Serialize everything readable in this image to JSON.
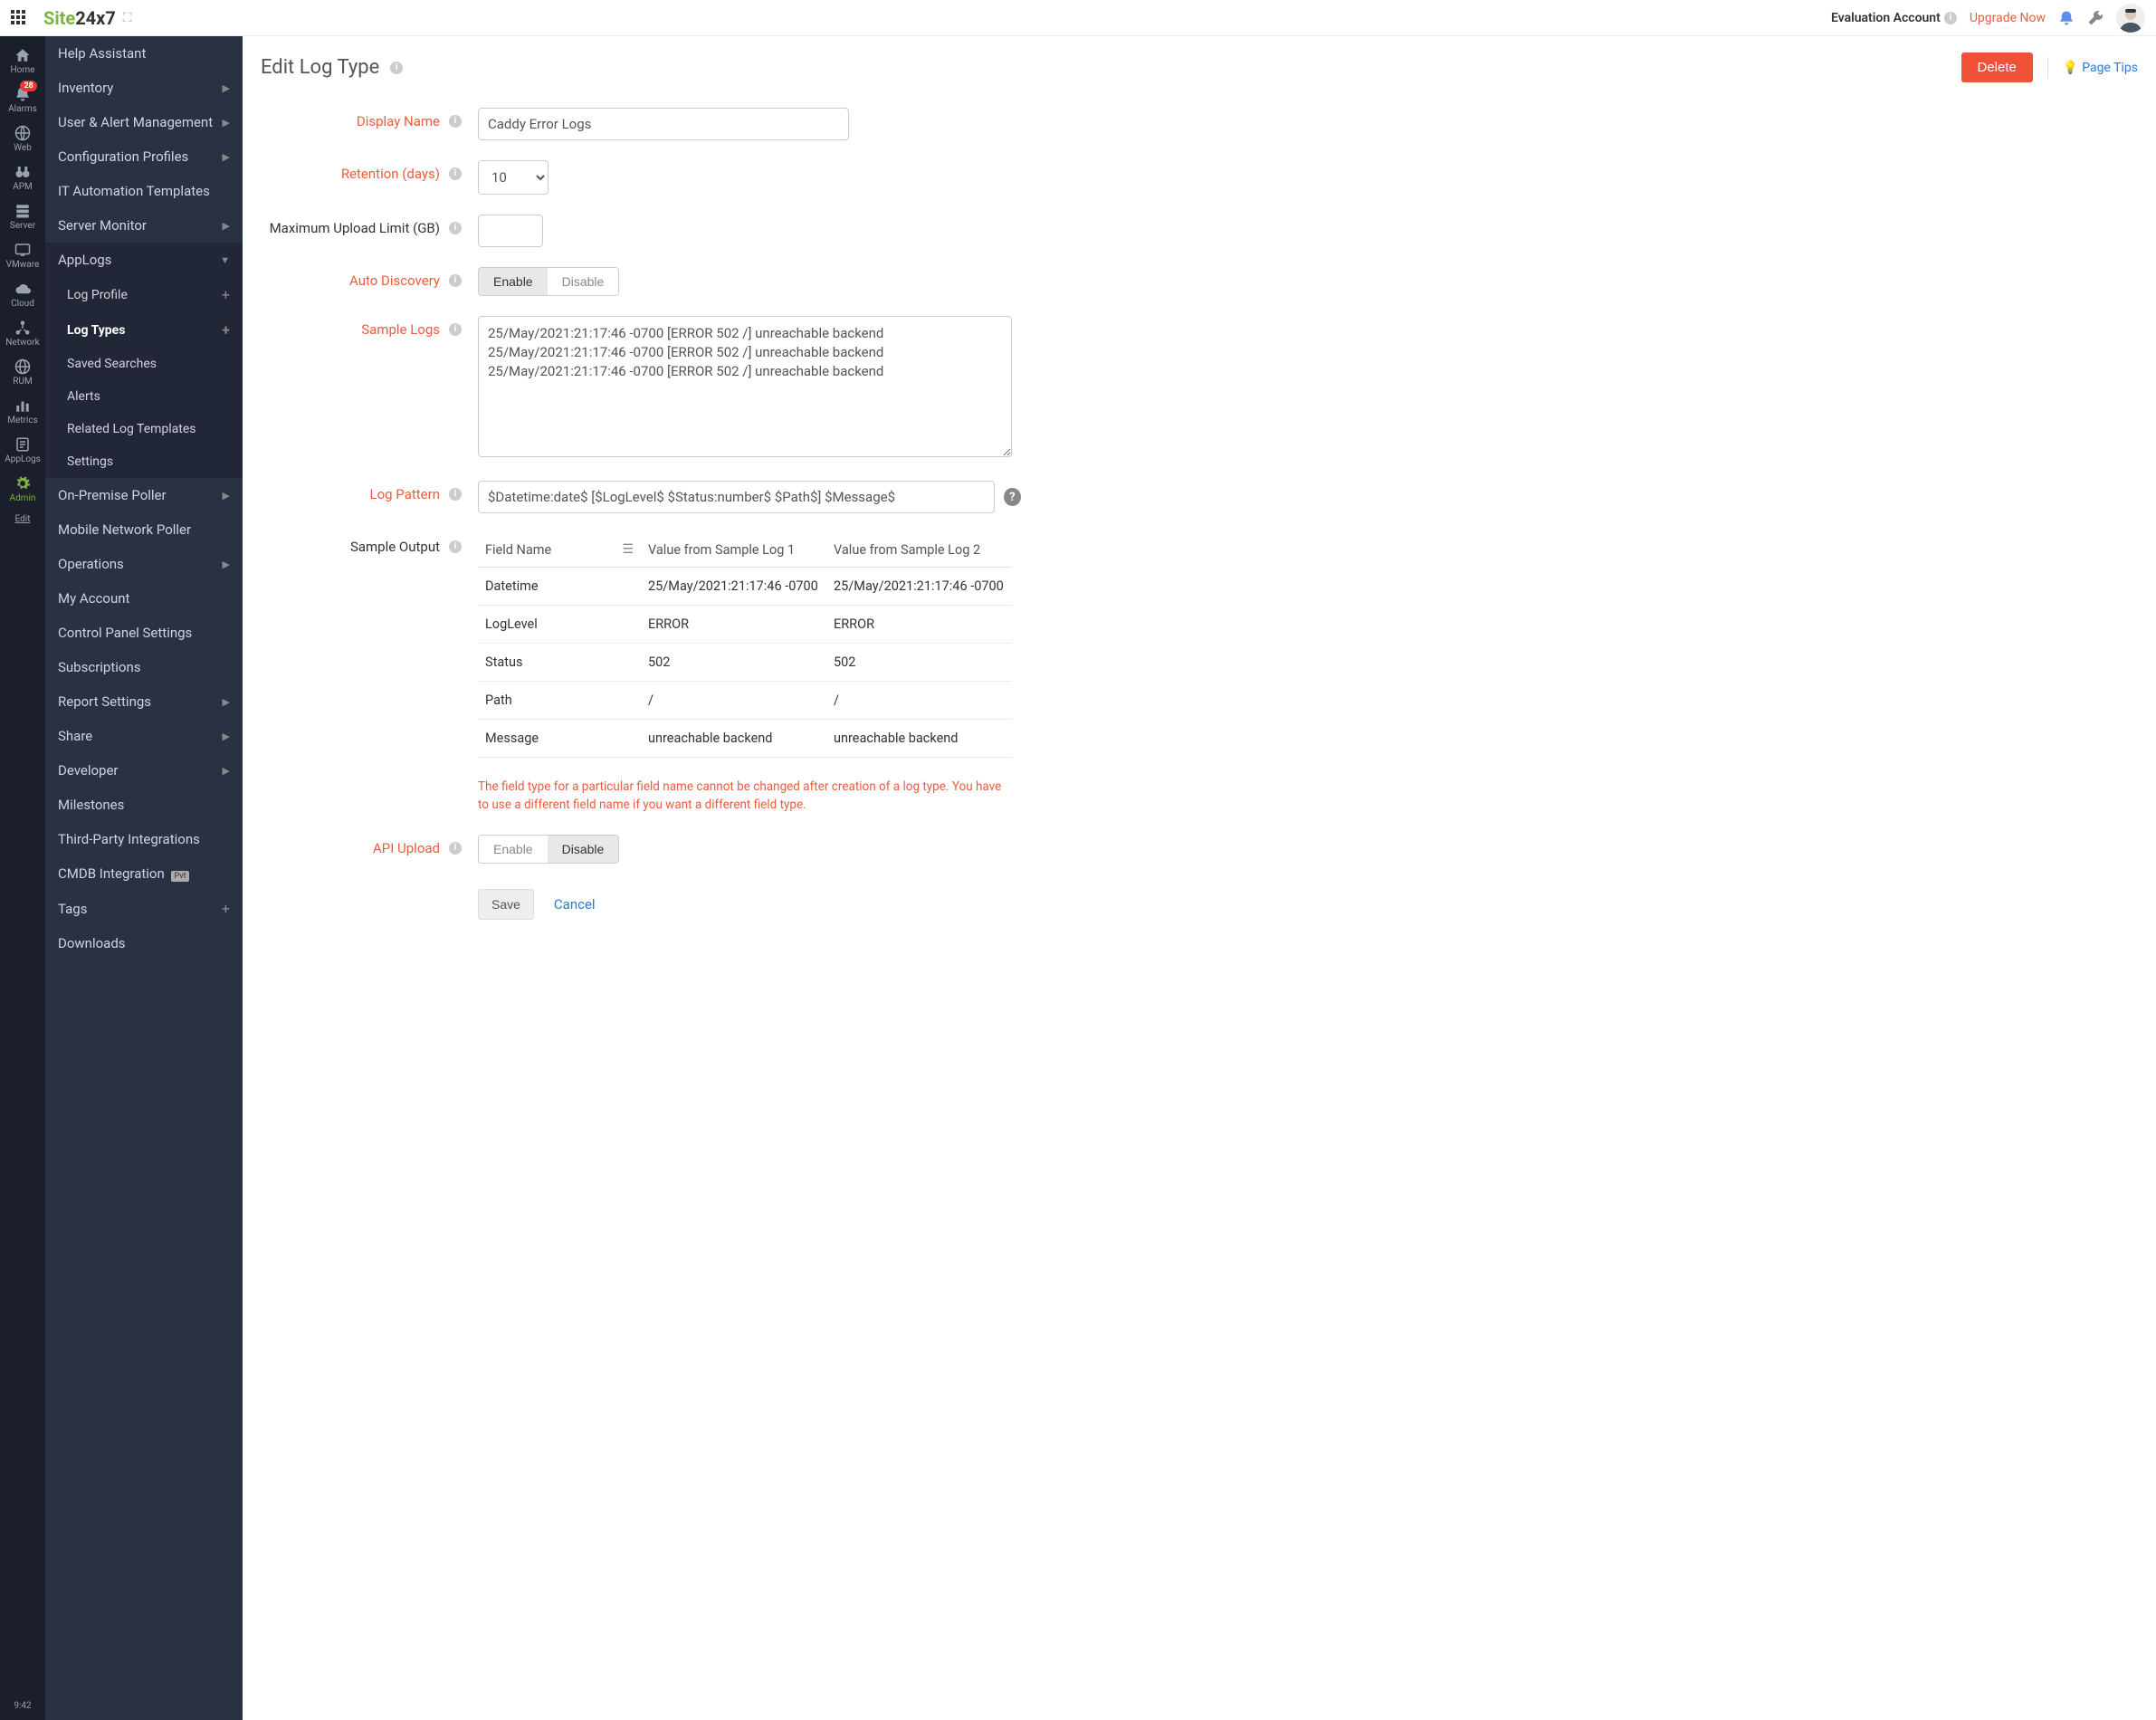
{
  "topbar": {
    "account_label": "Evaluation Account",
    "upgrade_label": "Upgrade Now"
  },
  "iconrail": {
    "items": [
      {
        "label": "Home",
        "icon": "home"
      },
      {
        "label": "Alarms",
        "icon": "bell",
        "badge": "28"
      },
      {
        "label": "Web",
        "icon": "globe"
      },
      {
        "label": "APM",
        "icon": "binoculars"
      },
      {
        "label": "Server",
        "icon": "server"
      },
      {
        "label": "VMware",
        "icon": "screen"
      },
      {
        "label": "Cloud",
        "icon": "cloud"
      },
      {
        "label": "Network",
        "icon": "net"
      },
      {
        "label": "RUM",
        "icon": "rum"
      },
      {
        "label": "Metrics",
        "icon": "metrics"
      },
      {
        "label": "AppLogs",
        "icon": "applogs"
      },
      {
        "label": "Admin",
        "icon": "gear",
        "active": true
      },
      {
        "label": "Edit",
        "icon": "",
        "underline": true
      }
    ],
    "time": "9:42"
  },
  "sidebar": {
    "items": [
      {
        "label": "Help Assistant"
      },
      {
        "label": "Inventory",
        "chev": true
      },
      {
        "label": "User & Alert Management",
        "chev": true
      },
      {
        "label": "Configuration Profiles",
        "chev": true
      },
      {
        "label": "IT Automation Templates"
      },
      {
        "label": "Server Monitor",
        "chev": true
      },
      {
        "label": "AppLogs",
        "chev_down": true,
        "section_active": true
      }
    ],
    "applogs_sub": [
      {
        "label": "Log Profile",
        "plus": true
      },
      {
        "label": "Log Types",
        "plus": true,
        "active": true
      },
      {
        "label": "Saved Searches"
      },
      {
        "label": "Alerts"
      },
      {
        "label": "Related Log Templates"
      },
      {
        "label": "Settings"
      }
    ],
    "items2": [
      {
        "label": "On-Premise Poller",
        "chev": true
      },
      {
        "label": "Mobile Network Poller"
      },
      {
        "label": "Operations",
        "chev": true
      },
      {
        "label": "My Account"
      },
      {
        "label": "Control Panel Settings"
      },
      {
        "label": "Subscriptions"
      },
      {
        "label": "Report Settings",
        "chev": true
      },
      {
        "label": "Share",
        "chev": true
      },
      {
        "label": "Developer",
        "chev": true
      },
      {
        "label": "Milestones"
      },
      {
        "label": "Third-Party Integrations"
      },
      {
        "label": "CMDB Integration",
        "pvt": "Pvt"
      },
      {
        "label": "Tags",
        "plus": true
      },
      {
        "label": "Downloads"
      }
    ]
  },
  "page": {
    "title": "Edit Log Type",
    "delete_label": "Delete",
    "page_tips_label": "Page Tips"
  },
  "form": {
    "display_name": {
      "label": "Display Name",
      "value": "Caddy Error Logs"
    },
    "retention": {
      "label": "Retention (days)",
      "value": "10"
    },
    "max_upload": {
      "label": "Maximum Upload Limit (GB)",
      "value": ""
    },
    "auto_discovery": {
      "label": "Auto Discovery",
      "enable": "Enable",
      "disable": "Disable",
      "active": "enable"
    },
    "sample_logs": {
      "label": "Sample Logs",
      "value": "25/May/2021:21:17:46 -0700 [ERROR 502 /] unreachable backend\n25/May/2021:21:17:46 -0700 [ERROR 502 /] unreachable backend\n25/May/2021:21:17:46 -0700 [ERROR 502 /] unreachable backend"
    },
    "log_pattern": {
      "label": "Log Pattern",
      "value": "$Datetime:date$ [$LogLevel$ $Status:number$ $Path$] $Message$"
    },
    "sample_output": {
      "label": "Sample Output",
      "col_field": "Field Name",
      "col_v1": "Value from Sample Log 1",
      "col_v2": "Value from Sample Log 2",
      "rows": [
        {
          "field": "Datetime",
          "v1": "25/May/2021:21:17:46 -0700",
          "v2": "25/May/2021:21:17:46 -0700"
        },
        {
          "field": "LogLevel",
          "v1": "ERROR",
          "v2": "ERROR"
        },
        {
          "field": "Status",
          "v1": "502",
          "v2": "502"
        },
        {
          "field": "Path",
          "v1": "/",
          "v2": "/"
        },
        {
          "field": "Message",
          "v1": "unreachable backend",
          "v2": "unreachable backend"
        }
      ]
    },
    "note": "The field type for a particular field name cannot be changed after creation of a log type. You have to use a different field name if you want a different field type.",
    "api_upload": {
      "label": "API Upload",
      "enable": "Enable",
      "disable": "Disable",
      "active": "disable"
    },
    "save_label": "Save",
    "cancel_label": "Cancel"
  }
}
